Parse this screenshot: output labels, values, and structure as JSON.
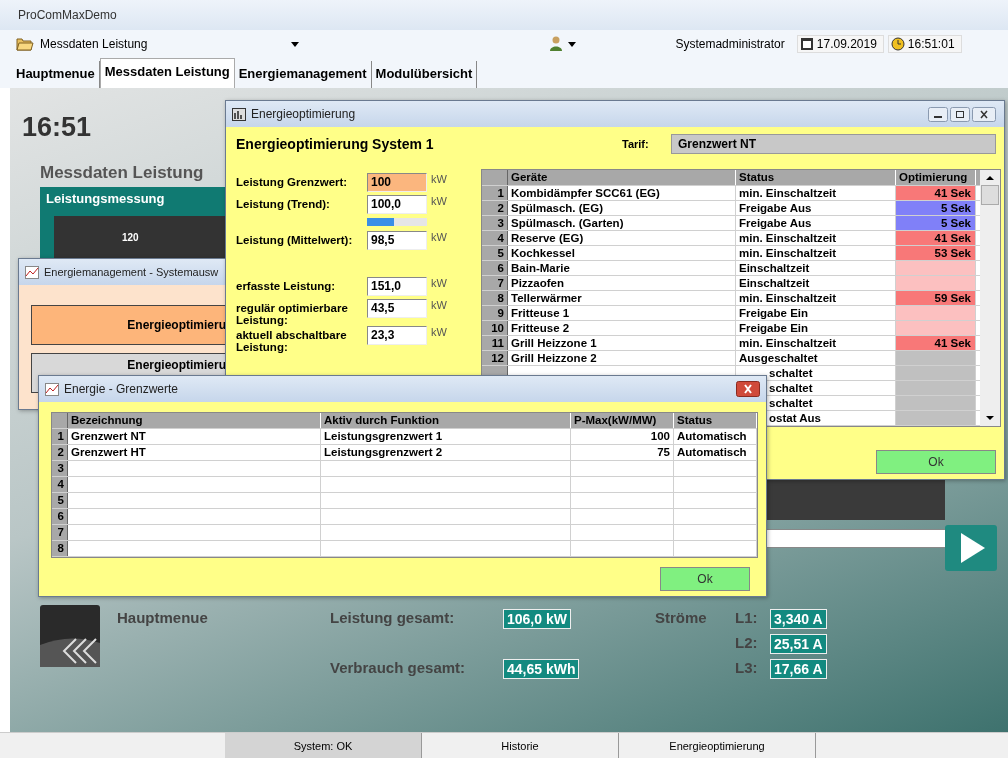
{
  "window": {
    "title": "ProComMaxDemo"
  },
  "toolbar": {
    "view": "Messdaten Leistung",
    "user": "Systemadministrator",
    "date": "17.09.2019",
    "time": "16:51:01"
  },
  "tabs": [
    {
      "label": "Hauptmenue",
      "selected": false
    },
    {
      "label": "Messdaten Leistung",
      "selected": true
    },
    {
      "label": "Energiemanagement",
      "selected": false
    },
    {
      "label": "Modulübersicht",
      "selected": false
    }
  ],
  "main": {
    "clock": "16:51",
    "heading": "Messdaten Leistung",
    "panel_title": "Leistungsmessung",
    "axis_label": "120"
  },
  "system_window": {
    "title": "Energiemanagement - Systemausw",
    "buttons": [
      {
        "label": "Energieoptimieru",
        "selected": true
      },
      {
        "label": "Energieoptimieru",
        "selected": false
      }
    ]
  },
  "optimization_window": {
    "title": "Energieoptimierung",
    "heading": "Energieoptimierung System 1",
    "tariff_label": "Tarif:",
    "tariff": "Grenzwert NT",
    "form_groups": [
      [
        {
          "kind": "field",
          "label": "Leistung Grenzwert:",
          "value": "100",
          "unit": "kW",
          "highlight": true
        },
        {
          "kind": "field",
          "label": "Leistung (Trend):",
          "value": "100,0",
          "unit": "kW",
          "highlight": false
        },
        {
          "kind": "progress",
          "level": 0.45
        },
        {
          "kind": "field",
          "label": "Leistung (Mittelwert):",
          "value": "98,5",
          "unit": "kW",
          "highlight": false
        }
      ],
      [
        {
          "kind": "field",
          "label": "erfasste Leistung:",
          "value": "151,0",
          "unit": "kW",
          "highlight": false
        },
        {
          "kind": "field",
          "label": "regulär optimierbare Leistung:",
          "value": "43,5",
          "unit": "kW",
          "highlight": false
        },
        {
          "kind": "field",
          "label": "aktuell abschaltbare Leistung:",
          "value": "23,3",
          "unit": "kW",
          "highlight": false
        }
      ]
    ],
    "table": {
      "columns": [
        "Geräte",
        "Status",
        "Optimierung"
      ],
      "rows": [
        {
          "number": "1",
          "device": "Kombidämpfer SCC61 (EG)",
          "status": "min. Einschaltzeit",
          "optimization": "41 Sek",
          "color": "#f87878"
        },
        {
          "number": "2",
          "device": "Spülmasch. (EG)",
          "status": "Freigabe Aus",
          "optimization": "5 Sek",
          "color": "#8080f8"
        },
        {
          "number": "3",
          "device": "Spülmasch. (Garten)",
          "status": "Freigabe Aus",
          "optimization": "5 Sek",
          "color": "#8080f8"
        },
        {
          "number": "4",
          "device": "Reserve (EG)",
          "status": "min. Einschaltzeit",
          "optimization": "41 Sek",
          "color": "#f87878"
        },
        {
          "number": "5",
          "device": "Kochkessel",
          "status": "min. Einschaltzeit",
          "optimization": "53 Sek",
          "color": "#f87878"
        },
        {
          "number": "6",
          "device": "Bain-Marie",
          "status": "Einschaltzeit",
          "color": "#fcc0c0"
        },
        {
          "number": "7",
          "device": "Pizzaofen",
          "status": "Einschaltzeit",
          "color": "#fcc0c0"
        },
        {
          "number": "8",
          "device": "Tellerwärmer",
          "status": "min. Einschaltzeit",
          "optimization": "59 Sek",
          "color": "#f87878"
        },
        {
          "number": "9",
          "device": "Fritteuse 1",
          "status": "Freigabe Ein",
          "color": "#fcc0c0"
        },
        {
          "number": "10",
          "device": "Fritteuse 2",
          "status": "Freigabe Ein",
          "color": "#fcc0c0"
        },
        {
          "number": "11",
          "device": "Grill Heizzone 1",
          "status": "min. Einschaltzeit",
          "optimization": "41 Sek",
          "color": "#f87878"
        },
        {
          "number": "12",
          "device": "Grill Heizzone 2",
          "status": "Ausgeschaltet",
          "color": "#c0c0c0"
        },
        {
          "status": "schaltet",
          "color": "#c0c0c0"
        },
        {
          "status": "schaltet",
          "color": "#c0c0c0"
        },
        {
          "status": "schaltet",
          "color": "#c0c0c0"
        },
        {
          "status": "ostat Aus",
          "color": "#c0c0c0"
        }
      ]
    },
    "ok": "Ok"
  },
  "limits_window": {
    "title": "Energie - Grenzwerte",
    "columns": [
      "Bezeichnung",
      "Aktiv durch Funktion",
      "P-Max(kW/MW)",
      "Status"
    ],
    "rows": [
      {
        "number": "1",
        "name": "Grenzwert NT",
        "function": "Leistungsgrenzwert 1",
        "pmax": "100",
        "status": "Automatisch"
      },
      {
        "number": "2",
        "name": "Grenzwert HT",
        "function": "Leistungsgrenzwert 2",
        "pmax": "75",
        "status": "Automatisch"
      },
      {
        "number": "3"
      },
      {
        "number": "4"
      },
      {
        "number": "5"
      },
      {
        "number": "6"
      },
      {
        "number": "7"
      },
      {
        "number": "8"
      }
    ],
    "ok": "Ok"
  },
  "summary": {
    "back_label": "Hauptmenue",
    "power_label": "Leistung gesamt:",
    "power": "106,0 kW",
    "energy_label": "Verbrauch gesamt:",
    "energy": "44,65 kWh",
    "currents_label": "Ströme",
    "currents": [
      {
        "phase": "L1:",
        "value": "3,340 A"
      },
      {
        "phase": "L2:",
        "value": "25,51 A"
      },
      {
        "phase": "L3:",
        "value": "17,66 A"
      }
    ]
  },
  "status_bar": [
    {
      "label": "System: OK",
      "selected": true
    },
    {
      "label": "Historie",
      "selected": false
    },
    {
      "label": "Energieoptimierung",
      "selected": false
    }
  ]
}
